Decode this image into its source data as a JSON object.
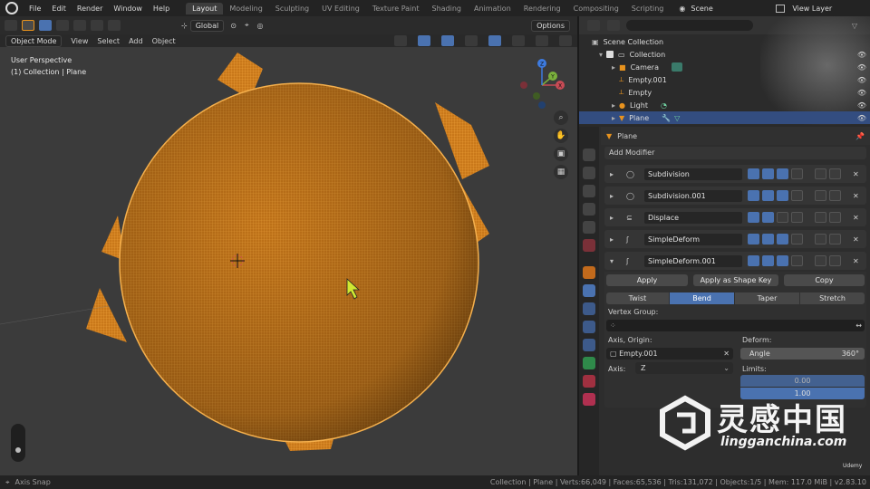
{
  "topbar": {
    "menus": [
      "File",
      "Edit",
      "Render",
      "Window",
      "Help"
    ],
    "workspaces": [
      "Layout",
      "Modeling",
      "Sculpting",
      "UV Editing",
      "Texture Paint",
      "Shading",
      "Animation",
      "Rendering",
      "Compositing",
      "Scripting"
    ],
    "active_workspace": "Layout",
    "scene": "Scene",
    "view_layer": "View Layer"
  },
  "viewport": {
    "mode": "Object Mode",
    "menus": [
      "View",
      "Select",
      "Add",
      "Object"
    ],
    "transform_orientation": "Global",
    "options_label": "Options",
    "perspective_label": "User Perspective",
    "collection_label": "(1) Collection | Plane",
    "gizmo_axes": [
      "X",
      "Y",
      "Z"
    ]
  },
  "outliner": {
    "root": "Scene Collection",
    "items": [
      {
        "label": "Collection",
        "depth": 1,
        "icon": "collection-icon",
        "selected": false
      },
      {
        "label": "Camera",
        "depth": 2,
        "icon": "camera-icon",
        "selected": false
      },
      {
        "label": "Empty.001",
        "depth": 2,
        "icon": "empty-icon",
        "selected": false
      },
      {
        "label": "Empty",
        "depth": 2,
        "icon": "empty-icon",
        "selected": false
      },
      {
        "label": "Light",
        "depth": 2,
        "icon": "light-icon",
        "selected": false
      },
      {
        "label": "Plane",
        "depth": 2,
        "icon": "mesh-icon",
        "selected": true
      }
    ]
  },
  "properties": {
    "object_name": "Plane",
    "add_modifier": "Add Modifier",
    "modifiers": [
      {
        "name": "Subdivision",
        "icon": "subdivision-icon",
        "expanded": false
      },
      {
        "name": "Subdivision.001",
        "icon": "subdivision-icon",
        "expanded": false
      },
      {
        "name": "Displace",
        "icon": "displace-icon",
        "expanded": false
      },
      {
        "name": "SimpleDeform",
        "icon": "simpledeform-icon",
        "expanded": false
      },
      {
        "name": "SimpleDeform.001",
        "icon": "simpledeform-icon",
        "expanded": true
      }
    ],
    "apply_label": "Apply",
    "apply_shape_label": "Apply as Shape Key",
    "copy_label": "Copy",
    "deform_modes": [
      "Twist",
      "Bend",
      "Taper",
      "Stretch"
    ],
    "active_deform_mode": "Bend",
    "vertex_group_label": "Vertex Group:",
    "axis_origin_label": "Axis, Origin:",
    "axis_origin_value": "Empty.001",
    "deform_label": "Deform:",
    "angle_label": "Angle",
    "angle_value": "360°",
    "axis_label": "Axis:",
    "axis_value": "Z",
    "limits_label": "Limits:",
    "limit_low": "0.00",
    "limit_high": "1.00"
  },
  "statusbar": {
    "left": "Axis Snap",
    "right": "Collection | Plane | Verts:66,049 | Faces:65,536 | Tris:131,072 | Objects:1/5 | Mem: 117.0 MiB | v2.83.10",
    "udemy": "Udemy"
  },
  "watermark": {
    "cn": "灵感中国",
    "url": "lingganchina.com"
  },
  "colors": {
    "accent_blue": "#4a72b0",
    "mesh_orange": "#e8931e",
    "selection_row": "#334d80"
  }
}
